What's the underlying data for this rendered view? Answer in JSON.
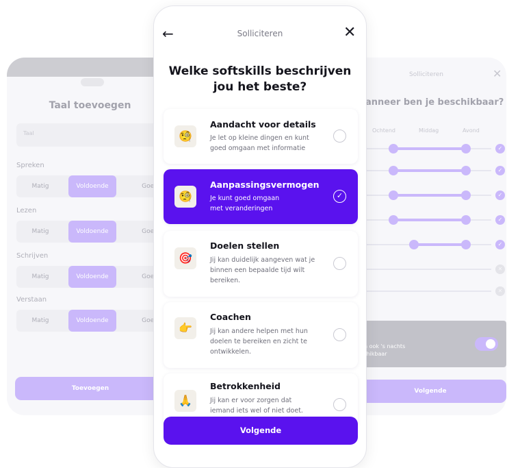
{
  "left_card": {
    "title": "Taal toevoegen",
    "input_placeholder": "Taal",
    "sections": [
      {
        "label": "Spreken",
        "options": [
          "Matig",
          "Voldoende",
          "Goed"
        ]
      },
      {
        "label": "Lezen",
        "options": [
          "Matig",
          "Voldoende",
          "Goed"
        ]
      },
      {
        "label": "Schrijven",
        "options": [
          "Matig",
          "Voldoende",
          "Goed"
        ]
      },
      {
        "label": "Verstaan",
        "options": [
          "Matig",
          "Voldoende",
          "Goed"
        ]
      }
    ],
    "selected_option": "Voldoende",
    "button_label": "Toevoegen"
  },
  "right_card": {
    "title": "Solliciteren",
    "close_icon": "close-icon",
    "question": "anneer ben je beschikbaar?",
    "columns": [
      "Ochtend",
      "Middag",
      "Avond"
    ],
    "rows_checked": [
      true,
      true,
      true,
      true,
      true,
      false,
      false
    ],
    "night_text_line1": "ben ook 's nachts",
    "night_text_line2": "eschikbaar",
    "night_toggle_on": true,
    "button_label": "Volgende"
  },
  "phone": {
    "back_icon": "arrow-left-icon",
    "title": "Solliciteren",
    "close_icon": "close-icon",
    "heading_line1": "Welke softskills beschrijven",
    "heading_line2": "jou het beste?",
    "skills": [
      {
        "title": "Aandacht voor details",
        "desc1": "Je let op kleine dingen en kunt",
        "desc2": "goed omgaan met informatie",
        "desc3": "",
        "emoji": "🧐",
        "selected": false
      },
      {
        "title": "Aanpassingsvermogen",
        "desc1": "Je kunt goed omgaan",
        "desc2": "met veranderingen",
        "desc3": "",
        "emoji": "🧐",
        "selected": true
      },
      {
        "title": "Doelen stellen",
        "desc1": "Jij kan duidelijk aangeven wat je",
        "desc2": "binnen een bepaalde tijd wilt",
        "desc3": "bereiken.",
        "emoji": "🎯",
        "selected": false
      },
      {
        "title": "Coachen",
        "desc1": "Jij kan andere helpen met hun",
        "desc2": "doelen te bereiken en zicht te",
        "desc3": "ontwikkelen.",
        "emoji": "👉",
        "selected": false
      },
      {
        "title": "Betrokkenheid",
        "desc1": "Jij kan er voor zorgen dat",
        "desc2": "iemand iets wel of niet doet.",
        "desc3": "",
        "emoji": "🙏",
        "selected": false
      }
    ],
    "cta_label": "Volgende"
  },
  "colors": {
    "accent": "#5a12ee",
    "accent_light": "#c6b3fb",
    "text_dark": "#14141c"
  }
}
